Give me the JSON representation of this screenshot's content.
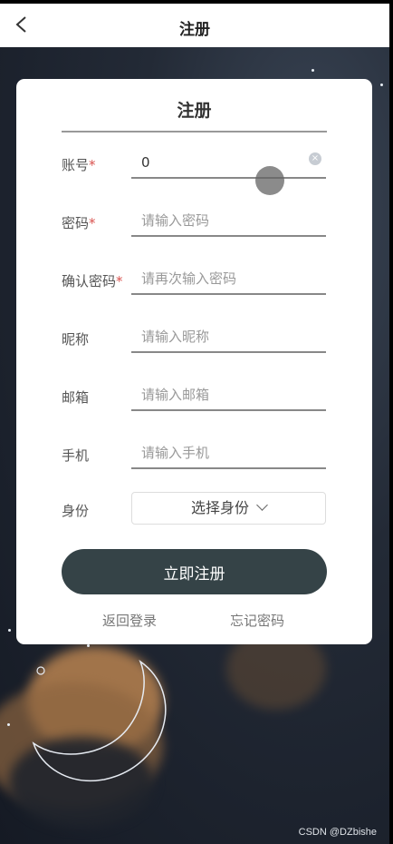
{
  "header": {
    "title": "注册",
    "back_icon": "chevron-left-icon"
  },
  "card": {
    "title": "注册",
    "fields": [
      {
        "label": "账号",
        "required": "*",
        "value": "0",
        "placeholder": ""
      },
      {
        "label": "密码",
        "required": "*",
        "value": "",
        "placeholder": "请输入密码"
      },
      {
        "label": "确认密码",
        "required": "*",
        "value": "",
        "placeholder": "请再次输入密码"
      },
      {
        "label": "昵称",
        "required": "",
        "value": "",
        "placeholder": "请输入昵称"
      },
      {
        "label": "邮箱",
        "required": "",
        "value": "",
        "placeholder": "请输入邮箱"
      },
      {
        "label": "手机",
        "required": "",
        "value": "",
        "placeholder": "请输入手机"
      }
    ],
    "identity": {
      "label": "身份",
      "select_text": "选择身份"
    },
    "submit_label": "立即注册",
    "back_to_login": "返回登录",
    "forgot_password": "忘记密码"
  },
  "watermark": "CSDN @DZbishe",
  "colors": {
    "button": "#354347",
    "required": "#d9534f",
    "background": "#1c2230",
    "cloud": "#c0854a"
  }
}
